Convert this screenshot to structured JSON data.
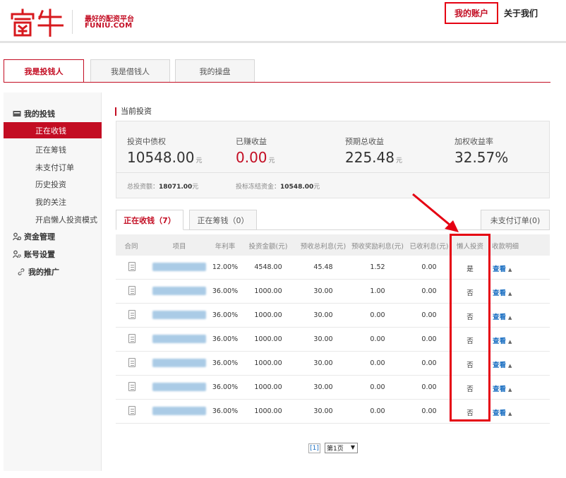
{
  "header": {
    "slogan": "最好的配资平台",
    "domain": "FUNIU.COM",
    "nav_account": "我的账户",
    "nav_about": "关于我们"
  },
  "role_tabs": [
    {
      "label": "我是投钱人",
      "active": true
    },
    {
      "label": "我是借钱人",
      "active": false
    },
    {
      "label": "我的操盘",
      "active": false
    }
  ],
  "sidebar": {
    "invest_group": "我的投钱",
    "invest_items": [
      "正在收钱",
      "正在筹钱",
      "未支付订单",
      "历史投资",
      "我的关注",
      "开启懒人投资模式"
    ],
    "funds_group": "资金管理",
    "account_group": "账号设置",
    "promo_group": "我的推广"
  },
  "summary": {
    "title": "当前投资",
    "items": [
      {
        "label": "投资中债权",
        "value": "10548.00",
        "unit": "元",
        "red": false
      },
      {
        "label": "已赚收益",
        "value": "0.00",
        "unit": "元",
        "red": true
      },
      {
        "label": "预期总收益",
        "value": "225.48",
        "unit": "元",
        "red": false
      },
      {
        "label": "加权收益率",
        "value": "32.57%",
        "unit": "",
        "red": false
      }
    ],
    "total_label": "总投资额：",
    "total_value": "18071.00",
    "total_unit": "元",
    "frozen_label": "投标冻结资金：",
    "frozen_value": "10548.00",
    "frozen_unit": "元"
  },
  "sub_tabs": [
    {
      "label": "正在收钱（7）",
      "active": true
    },
    {
      "label": "正在筹钱（0）",
      "active": false
    }
  ],
  "unpaid_button": "未支付订单(0)",
  "table": {
    "headers": [
      "合同",
      "项目",
      "年利率",
      "投资金额(元)",
      "预收总利息(元)",
      "预收奖励利息(元)",
      "已收利息(元)",
      "懒人投资",
      "收款明细"
    ],
    "view_label": "查看",
    "rows": [
      {
        "rate": "12.00%",
        "amount": "4548.00",
        "interest": "45.48",
        "reward": "1.52",
        "received": "0.00",
        "lazy": "是"
      },
      {
        "rate": "36.00%",
        "amount": "1000.00",
        "interest": "30.00",
        "reward": "1.00",
        "received": "0.00",
        "lazy": "否"
      },
      {
        "rate": "36.00%",
        "amount": "1000.00",
        "interest": "30.00",
        "reward": "0.00",
        "received": "0.00",
        "lazy": "否"
      },
      {
        "rate": "36.00%",
        "amount": "1000.00",
        "interest": "30.00",
        "reward": "0.00",
        "received": "0.00",
        "lazy": "否"
      },
      {
        "rate": "36.00%",
        "amount": "1000.00",
        "interest": "30.00",
        "reward": "0.00",
        "received": "0.00",
        "lazy": "否"
      },
      {
        "rate": "36.00%",
        "amount": "1000.00",
        "interest": "30.00",
        "reward": "0.00",
        "received": "0.00",
        "lazy": "否"
      },
      {
        "rate": "36.00%",
        "amount": "1000.00",
        "interest": "30.00",
        "reward": "0.00",
        "received": "0.00",
        "lazy": "否"
      }
    ]
  },
  "pager": {
    "current": "[1]",
    "select": "第1页"
  },
  "colors": {
    "brand": "#c30d23",
    "highlight": "#e50012",
    "link": "#1b6fc2"
  }
}
